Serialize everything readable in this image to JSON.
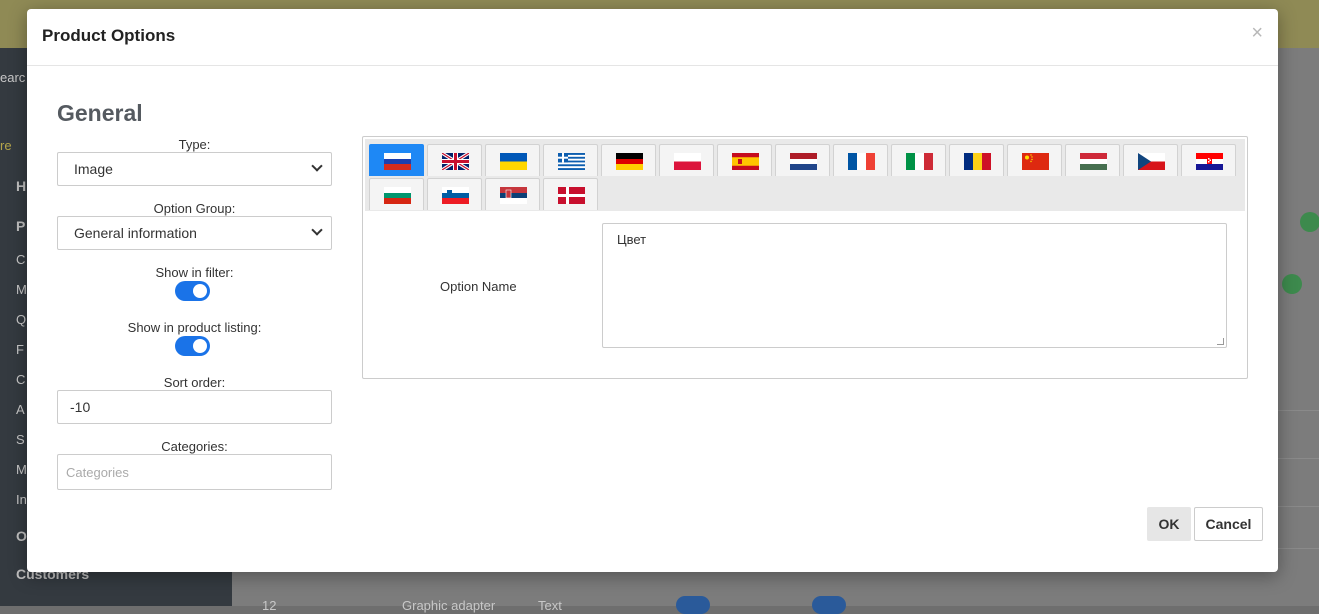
{
  "background": {
    "search_fragment": "earc",
    "sidebar_items": [
      "re",
      "H",
      "P",
      "C",
      "M",
      "Q",
      "F",
      "C",
      "A",
      "S",
      "M",
      "In",
      "O",
      "Customers"
    ],
    "table_row_fragment": [
      "12",
      "Graphic adapter",
      "Text"
    ]
  },
  "modal": {
    "title": "Product Options",
    "close_glyph": "×",
    "section_title": "General",
    "type": {
      "label": "Type:",
      "value": "Image"
    },
    "option_group": {
      "label": "Option Group:",
      "value": "General information"
    },
    "show_in_filter": {
      "label": "Show in filter:",
      "enabled": true
    },
    "show_in_listing": {
      "label": "Show in product listing:",
      "enabled": true
    },
    "sort_order": {
      "label": "Sort order:",
      "value": "-10"
    },
    "categories": {
      "label": "Categories:",
      "placeholder": "Categories"
    },
    "languages": [
      "ru",
      "en-gb",
      "ua",
      "gr",
      "de",
      "pl",
      "es",
      "nl",
      "fr",
      "it",
      "ro",
      "cn",
      "hu",
      "cz",
      "hr",
      "bg",
      "si",
      "rs",
      "dk"
    ],
    "active_language": "ru",
    "option_name": {
      "label": "Option Name",
      "value": "Цвет"
    },
    "buttons": {
      "ok": "OK",
      "cancel": "Cancel"
    }
  },
  "colors": {
    "accent": "#1e88f5",
    "toggle_on": "#1a73e8"
  }
}
